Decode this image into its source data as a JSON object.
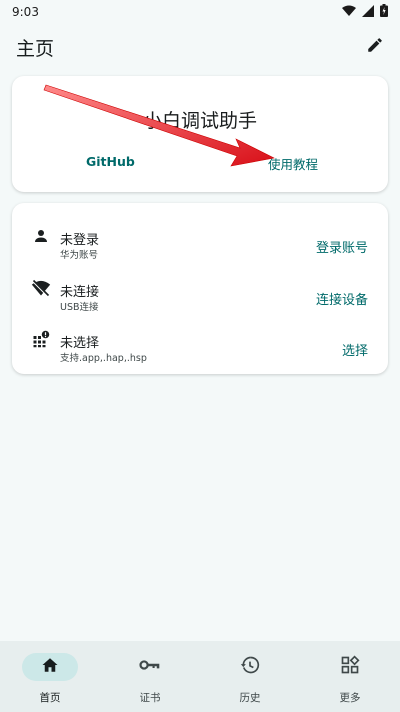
{
  "status": {
    "time": "9:03"
  },
  "header": {
    "title": "主页"
  },
  "app_card": {
    "app_name": "小白调试助手",
    "github_label": "GitHub",
    "tutorial_label": "使用教程"
  },
  "rows": [
    {
      "title": "未登录",
      "subtitle": "华为账号",
      "action": "登录账号"
    },
    {
      "title": "未连接",
      "subtitle": "USB连接",
      "action": "连接设备"
    },
    {
      "title": "未选择",
      "subtitle": "支持.app,.hap,.hsp",
      "action": "选择"
    }
  ],
  "nav": [
    {
      "label": "首页",
      "icon": "home-icon",
      "active": true
    },
    {
      "label": "证书",
      "icon": "key-icon",
      "active": false
    },
    {
      "label": "历史",
      "icon": "history-icon",
      "active": false
    },
    {
      "label": "更多",
      "icon": "widgets-icon",
      "active": false
    }
  ],
  "colors": {
    "accent": "#006a6a",
    "background": "#f4f9f9",
    "nav_active": "#cce8e8",
    "arrow": "#e8141c"
  }
}
